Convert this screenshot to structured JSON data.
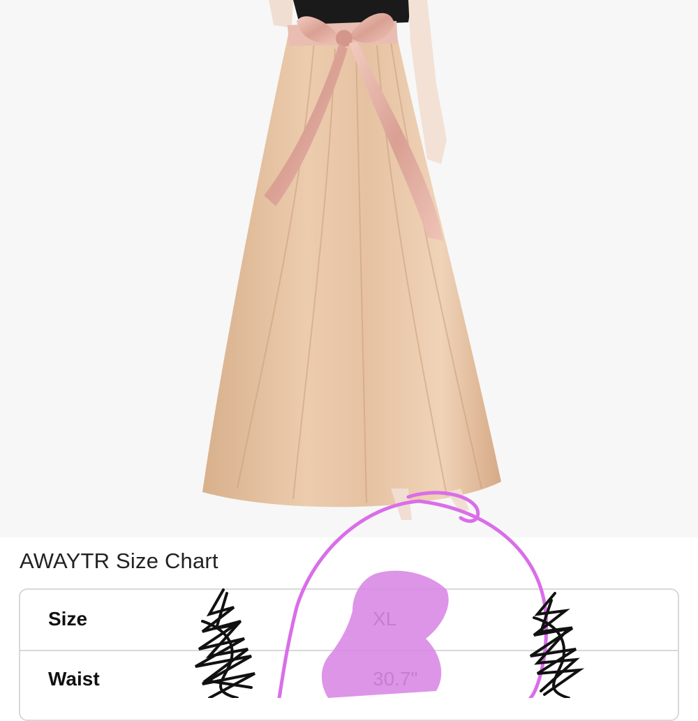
{
  "chart": {
    "title": "AWAYTR Size Chart",
    "rows": [
      {
        "label": "Size",
        "value": "XL"
      },
      {
        "label": "Waist",
        "value": "30.7\""
      }
    ]
  },
  "colors": {
    "skirt": "#e3c1a0",
    "sash": "#e8b8ad",
    "circle_annotation": "#d96ee8",
    "highlight_annotation": "#d98ae4",
    "scribble": "#111111",
    "table_border": "#d8d8d8"
  },
  "annotations": {
    "circle": "marker-circle-around-xl-column",
    "highlight": "marker-highlight-over-xl",
    "scribbles": "black-scribbles-over-other-sizes"
  }
}
